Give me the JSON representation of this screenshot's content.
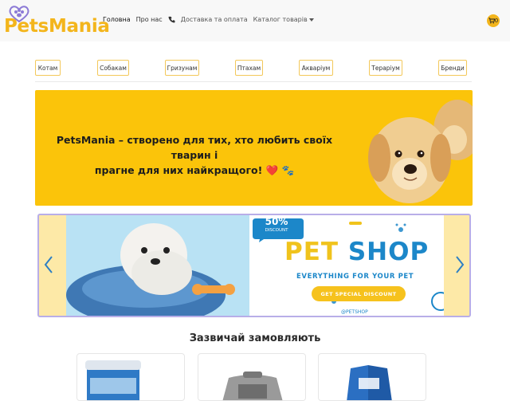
{
  "brand": {
    "name": "PetsMania",
    "color": "#f3b51c"
  },
  "nav": {
    "items": [
      {
        "label": "Головна"
      },
      {
        "label": "Про нас"
      },
      {
        "label": "Доставка та оплата"
      },
      {
        "label": "Каталог товарів"
      }
    ],
    "cart_count": "0"
  },
  "categories": [
    "Котам",
    "Собакам",
    "Гризунам",
    "Птахам",
    "Акваріум",
    "Тераріум",
    "Бренди"
  ],
  "hero": {
    "line1": "PetsMania – створено для тих, хто любить своїх тварин і",
    "line2": "прагне для них найкращого! ❤️ 🐾"
  },
  "promo_banner": {
    "discount_percent": "50%",
    "discount_label": "DISCOUNT",
    "headline_a": "PET",
    "headline_b": "SHOP",
    "tagline": "EVERYTHING FOR YOUR PET",
    "cta": "GET SPECIAL DISCOUNT",
    "handle": "@PETSHOP"
  },
  "popular": {
    "title": "Зазвичай замовляють"
  },
  "colors": {
    "accent": "#fbc40a",
    "banner_bg": "#b9e2f4",
    "blue": "#1c87c9",
    "carousel_border": "#b8aee8"
  }
}
